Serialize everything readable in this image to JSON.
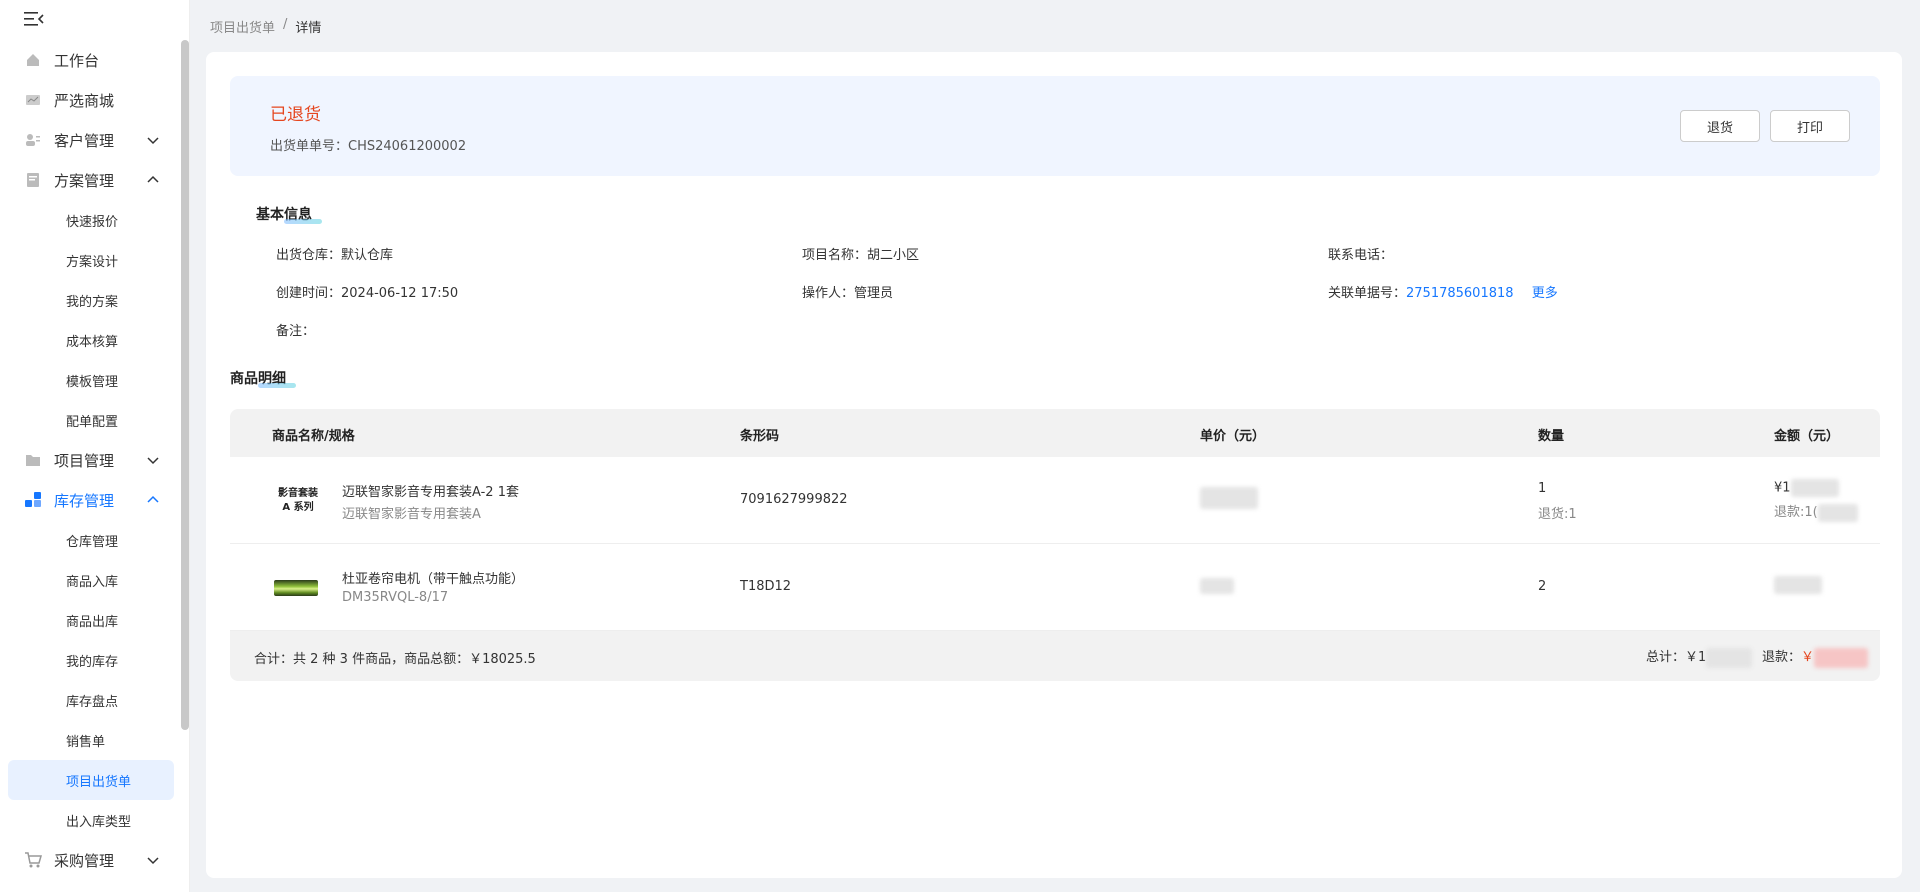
{
  "sidebar": {
    "items": [
      {
        "label": "工作台",
        "icon": "home-icon"
      },
      {
        "label": "严选商城",
        "icon": "shop-icon"
      },
      {
        "label": "客户管理",
        "icon": "customer-icon",
        "expanded": false
      },
      {
        "label": "方案管理",
        "icon": "plan-icon",
        "expanded": true,
        "children": [
          "快速报价",
          "方案设计",
          "我的方案",
          "成本核算",
          "模板管理",
          "配单配置"
        ]
      },
      {
        "label": "项目管理",
        "icon": "folder-icon",
        "expanded": false
      },
      {
        "label": "库存管理",
        "icon": "inventory-icon",
        "expanded": true,
        "children": [
          "仓库管理",
          "商品入库",
          "商品出库",
          "我的库存",
          "库存盘点",
          "销售单",
          "项目出货单",
          "出入库类型"
        ]
      },
      {
        "label": "采购管理",
        "icon": "cart-icon",
        "expanded": false
      }
    ],
    "active_child": "项目出货单"
  },
  "breadcrumb": {
    "parent": "项目出货单",
    "separator": "/",
    "current": "详情"
  },
  "status": {
    "title": "已退货",
    "order_no_label": "出货单单号：",
    "order_no": "CHS24061200002",
    "buttons": {
      "return": "退货",
      "print": "打印"
    }
  },
  "basic_info": {
    "title": "基本信息",
    "warehouse_label": "出货仓库：",
    "warehouse": "默认仓库",
    "project_label": "项目名称：",
    "project": "胡二小区",
    "phone_label": "联系电话：",
    "phone": "",
    "created_label": "创建时间：",
    "created": "2024-06-12 17:50",
    "operator_label": "操作人：",
    "operator": "管理员",
    "related_label": "关联单据号：",
    "related": "2751785601818",
    "more": "更多",
    "remark_label": "备注：",
    "remark": ""
  },
  "goods": {
    "title": "商品明细",
    "columns": [
      "商品名称/规格",
      "条形码",
      "单价（元）",
      "数量",
      "金额（元）"
    ],
    "rows": [
      {
        "thumb": "影音套装\nA 系列",
        "name": "迈联智家影音专用套装A-2 1套",
        "spec": "迈联智家影音专用套装A",
        "barcode": "7091627999822",
        "qty": "1",
        "returned": "退货:1",
        "amount_prefix": "¥1",
        "refund_prefix": "退款:1("
      },
      {
        "thumb": "",
        "name": "杜亚卷帘电机（带干触点功能）",
        "spec": "DM35RVQL-8/17",
        "barcode": "T18D12",
        "qty": "2",
        "returned": "",
        "amount_prefix": "",
        "refund_prefix": ""
      }
    ],
    "footer": {
      "summary": "合计：共 2 种 3 件商品，商品总额：￥18025.5",
      "total_label": "总计：￥1",
      "refund_label": "退款：",
      "refund_currency": "￥"
    }
  },
  "colors": {
    "accent": "#1677ff",
    "status": "#e5461f",
    "panel": "#f0f5ff"
  }
}
